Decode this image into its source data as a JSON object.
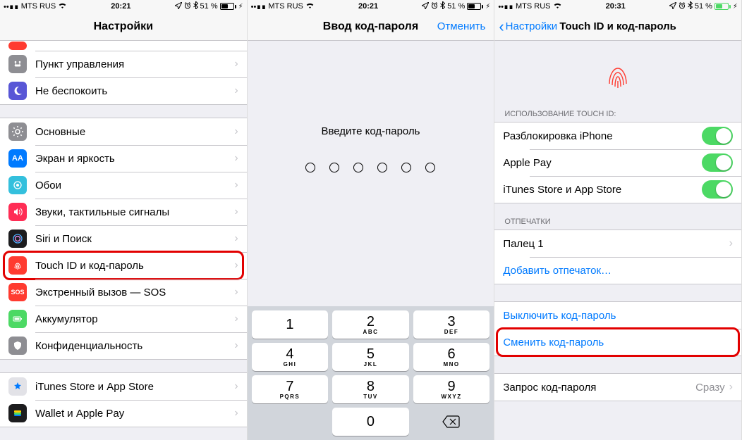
{
  "status": {
    "carrier": "MTS RUS",
    "time1": "20:21",
    "time2": "20:21",
    "time3": "20:31",
    "battery": "51 %"
  },
  "screen1": {
    "title": "Настройки",
    "items_g1": [
      {
        "label": "Пункт управления"
      },
      {
        "label": "Не беспокоить"
      }
    ],
    "items_g2": [
      {
        "label": "Основные"
      },
      {
        "label": "Экран и яркость"
      },
      {
        "label": "Обои"
      },
      {
        "label": "Звуки, тактильные сигналы"
      },
      {
        "label": "Siri и Поиск"
      },
      {
        "label": "Touch ID и код-пароль"
      },
      {
        "label": "Экстренный вызов — SOS"
      },
      {
        "label": "Аккумулятор"
      },
      {
        "label": "Конфиденциальность"
      }
    ],
    "items_g3": [
      {
        "label": "iTunes Store и App Store"
      },
      {
        "label": "Wallet и Apple Pay"
      }
    ]
  },
  "screen2": {
    "title": "Ввод код-пароля",
    "cancel": "Отменить",
    "prompt": "Введите код-пароль",
    "keys": [
      {
        "n": "1",
        "l": ""
      },
      {
        "n": "2",
        "l": "ABC"
      },
      {
        "n": "3",
        "l": "DEF"
      },
      {
        "n": "4",
        "l": "GHI"
      },
      {
        "n": "5",
        "l": "JKL"
      },
      {
        "n": "6",
        "l": "MNO"
      },
      {
        "n": "7",
        "l": "PQRS"
      },
      {
        "n": "8",
        "l": "TUV"
      },
      {
        "n": "9",
        "l": "WXYZ"
      },
      {
        "blank": true
      },
      {
        "n": "0",
        "l": ""
      },
      {
        "del": true
      }
    ]
  },
  "screen3": {
    "back": "Настройки",
    "title": "Touch ID и код-пароль",
    "section_use": "ИСПОЛЬЗОВАНИЕ TOUCH ID:",
    "toggles": [
      {
        "label": "Разблокировка iPhone"
      },
      {
        "label": "Apple Pay"
      },
      {
        "label": "iTunes Store и App Store"
      }
    ],
    "section_prints": "ОТПЕЧАТКИ",
    "finger": "Палец 1",
    "add_finger": "Добавить отпечаток…",
    "turn_off": "Выключить код-пароль",
    "change": "Сменить код-пароль",
    "require_label": "Запрос код-пароля",
    "require_value": "Сразу"
  }
}
